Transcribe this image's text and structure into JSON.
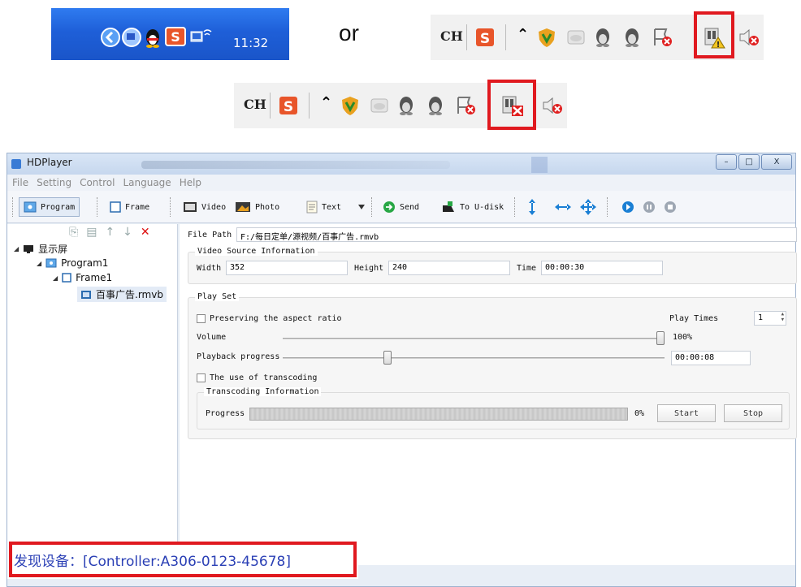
{
  "xp_taskbar": {
    "clock": "11:32",
    "ime_label": "S"
  },
  "or_label": "or",
  "tray1": {
    "ime": "CH",
    "sogou": "S",
    "expand": "⌃"
  },
  "tray2": {
    "ime": "CH",
    "sogou": "S",
    "expand": "⌃"
  },
  "window": {
    "title": "HDPlayer",
    "controls": [
      "–",
      "□",
      "X"
    ]
  },
  "menu": [
    "File",
    "Setting",
    "Control",
    "Language",
    "Help"
  ],
  "toolbar": {
    "program": "Program",
    "frame": "Frame",
    "video": "Video",
    "photo": "Photo",
    "text": "Text",
    "send": "Send",
    "usb": "To U-disk"
  },
  "tree": {
    "root": "显示屏",
    "program": "Program1",
    "frame": "Frame1",
    "file": "百事广告.rmvb"
  },
  "panel": {
    "file_path_label": "File Path",
    "file_path": "F:/每日定单/源视频/百事广告.rmvb",
    "video_source_title": "Video Source Information",
    "width_label": "Width",
    "width": "352",
    "height_label": "Height",
    "height": "240",
    "time_label": "Time",
    "time": "00:00:30",
    "play_set_title": "Play Set",
    "aspect_label": "Preserving the aspect ratio",
    "play_times_label": "Play Times",
    "play_times": "1",
    "volume_label": "Volume",
    "volume_value": "100%",
    "volume_fraction": 1.0,
    "playback_label": "Playback progress",
    "playback_time": "00:00:08",
    "playback_fraction": 0.27,
    "transcode_label": "The use of transcoding",
    "transcode_info_title": "Transcoding Information",
    "progress_label": "Progress",
    "progress_value": "0%",
    "start": "Start",
    "stop": "Stop"
  },
  "status": {
    "found_device": "发现设备：[Controller:A306-0123-45678]"
  },
  "colors": {
    "highlight_red": "#e0191f",
    "status_blue": "#2a3fb5",
    "xp_blue": "#1e5fd8"
  }
}
